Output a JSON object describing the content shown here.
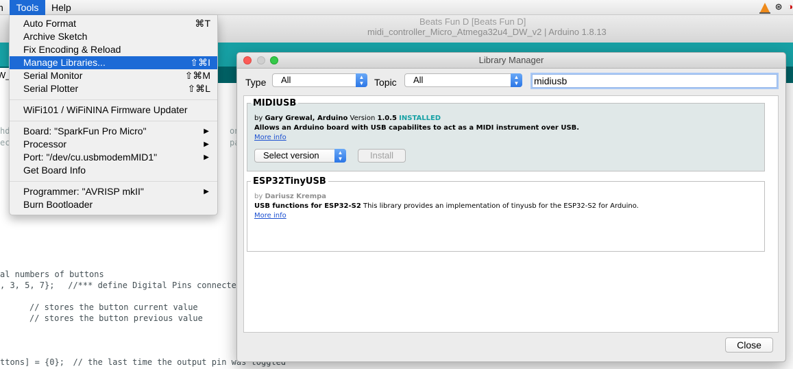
{
  "menubar": {
    "partial_prev": "n",
    "tools": "Tools",
    "help": "Help"
  },
  "ide": {
    "title_behind": "Beats Fun D [Beats Fun D]",
    "title": "midi_controller_Micro_Atmega32u4_DW_v2 | Arduino 1.8.13",
    "tab_label": "W_",
    "code": {
      "l1": "hd",
      "l1r": "onar",
      "l2": "ec",
      "l2r": "park",
      "l3": "al numbers of buttons",
      "l4a": ", 3, 5, 7};",
      "l4b": " //*** define Digital Pins connected f",
      "l5": "// stores the button current value",
      "l6": "// stores the button previous value",
      "l7a": "ttons] = {0};",
      "l7b": "  // the last time the output pin was toggled"
    }
  },
  "tools_menu": {
    "items": [
      {
        "label": "Auto Format",
        "shortcut": "⌘T"
      },
      {
        "label": "Archive Sketch",
        "shortcut": ""
      },
      {
        "label": "Fix Encoding & Reload",
        "shortcut": ""
      },
      {
        "label": "Manage Libraries...",
        "shortcut": "⇧⌘I"
      },
      {
        "label": "Serial Monitor",
        "shortcut": "⇧⌘M"
      },
      {
        "label": "Serial Plotter",
        "shortcut": "⇧⌘L"
      },
      {
        "label": "WiFi101 / WiFiNINA Firmware Updater",
        "shortcut": ""
      },
      {
        "label": "Board: \"SparkFun Pro Micro\"",
        "shortcut": "▶"
      },
      {
        "label": "Processor",
        "shortcut": "▶"
      },
      {
        "label": "Port: \"/dev/cu.usbmodemMID1\"",
        "shortcut": "▶"
      },
      {
        "label": "Get Board Info",
        "shortcut": ""
      },
      {
        "label": "Programmer: \"AVRISP mkII\"",
        "shortcut": "▶"
      },
      {
        "label": "Burn Bootloader",
        "shortcut": ""
      }
    ]
  },
  "library_manager": {
    "title": "Library Manager",
    "type_label": "Type",
    "type_value": "All",
    "topic_label": "Topic",
    "topic_value": "All",
    "search_value": "midiusb",
    "results": [
      {
        "name": "MIDIUSB",
        "by": "by",
        "author": "Gary Grewal, Arduino",
        "version_label": "Version",
        "version": "1.0.5",
        "status": "INSTALLED",
        "description": "Allows an Arduino board with USB capabilites to act as a MIDI instrument over USB.",
        "more_info": "More info",
        "select_version": "Select version",
        "install": "Install"
      },
      {
        "name": "ESP32TinyUSB",
        "by": "by",
        "author": "Dariusz Krempa",
        "summary": "USB functions for ESP32-S2",
        "description": " This library provides an implementation of tinyusb for the ESP32-S2 for Arduino.",
        "more_info": "More info"
      }
    ],
    "close": "Close"
  },
  "colors": {
    "selection": "#1c6ad6",
    "arduino_teal": "#17a1a5",
    "installed": "#17a1a5"
  }
}
